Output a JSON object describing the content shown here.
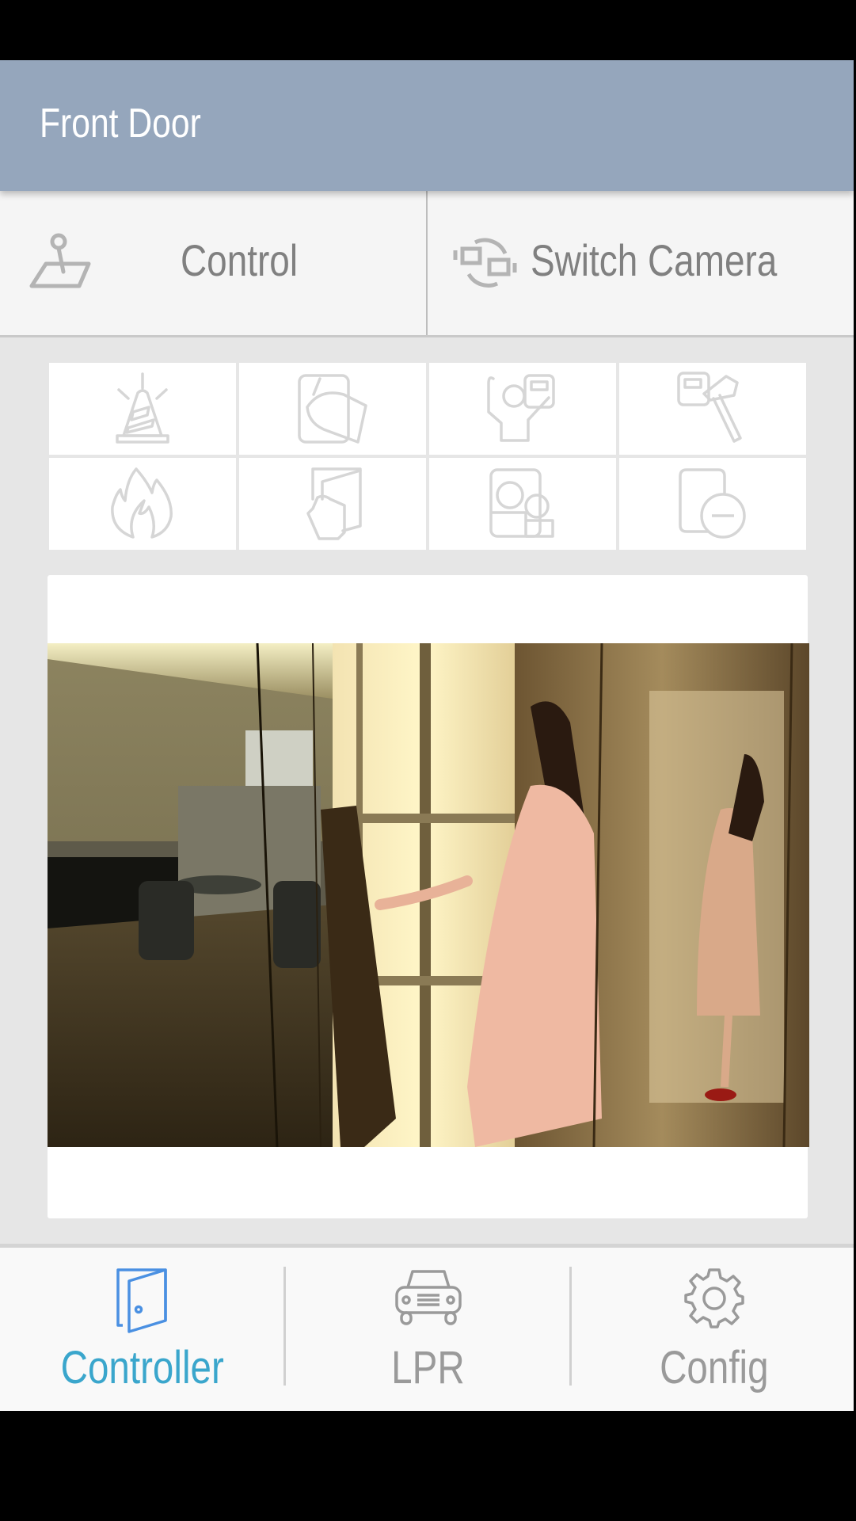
{
  "appbar": {
    "title": "Front Door"
  },
  "tabs": [
    {
      "label": "Control",
      "icon": "joystick-icon"
    },
    {
      "label": "Switch Camera",
      "icon": "switch-camera-icon"
    }
  ],
  "action_grid": [
    {
      "icon": "alarm-cone-icon"
    },
    {
      "icon": "forced-entry-icon"
    },
    {
      "icon": "user-card-reader-icon"
    },
    {
      "icon": "tamper-hammer-icon"
    },
    {
      "icon": "fire-icon"
    },
    {
      "icon": "door-push-icon"
    },
    {
      "icon": "users-group-icon"
    },
    {
      "icon": "door-remove-icon"
    }
  ],
  "camera": {
    "feed": "live-camera-feed"
  },
  "bottom_nav": {
    "active": "Controller",
    "items": [
      {
        "label": "Controller",
        "icon": "door-icon"
      },
      {
        "label": "LPR",
        "icon": "car-icon"
      },
      {
        "label": "Config",
        "icon": "gear-icon"
      }
    ]
  },
  "colors": {
    "appbar": "#95a6bc",
    "accent": "#3aa6cc",
    "icon_active": "#4a90e2",
    "inactive": "#9a9a9a"
  }
}
